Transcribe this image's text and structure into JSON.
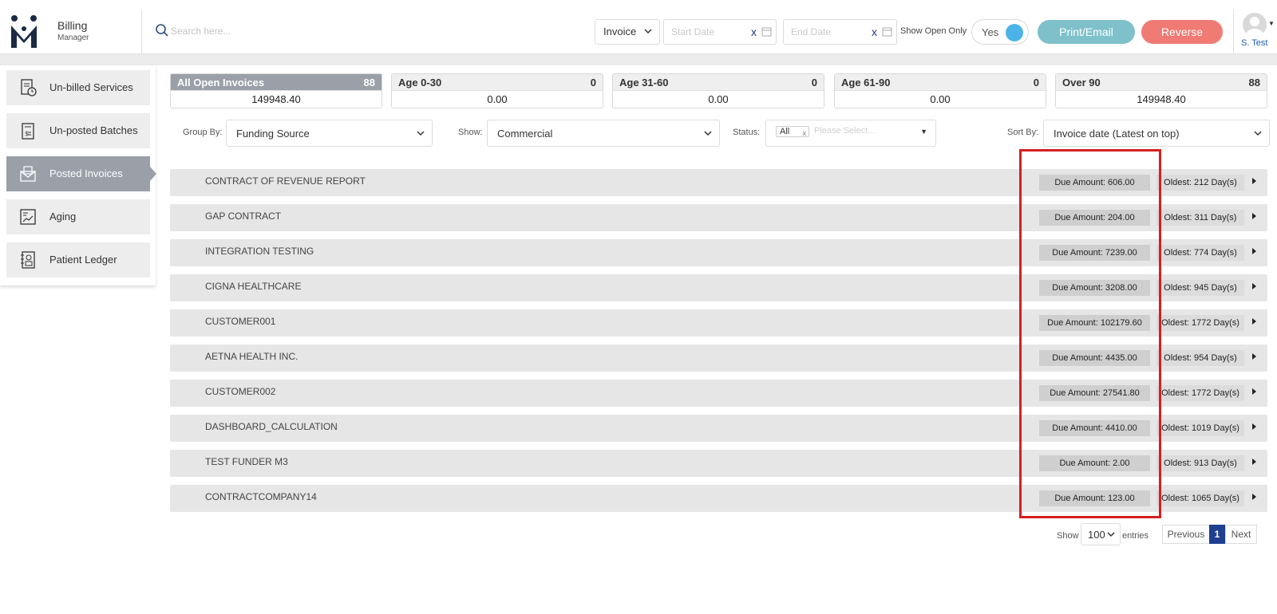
{
  "app": {
    "brand_title": "Billing",
    "brand_subtitle": "Manager"
  },
  "header": {
    "search_placeholder": "Search here...",
    "type_select": "Invoice",
    "start_date_placeholder": "Start Date",
    "end_date_placeholder": "End Date",
    "clear_label": "x",
    "show_open_only_label": "Show Open Only",
    "toggle_value": "Yes",
    "print_email_label": "Print/Email",
    "reverse_label": "Reverse",
    "user_name": "S. Test",
    "colors": {
      "print": "#7ec1cb",
      "reverse": "#ef7b74",
      "toggle": "#4cb3e8"
    }
  },
  "sidebar": {
    "items": [
      {
        "label": "Un-billed Services",
        "icon": "document-clock-icon"
      },
      {
        "label": "Un-posted Batches",
        "icon": "document-dollar-icon"
      },
      {
        "label": "Posted Invoices",
        "icon": "envelope-icon",
        "active": true
      },
      {
        "label": "Aging",
        "icon": "chart-report-icon"
      },
      {
        "label": "Patient Ledger",
        "icon": "ledger-book-icon"
      }
    ]
  },
  "summary": [
    {
      "name": "All Open Invoices",
      "count": "88",
      "amount": "149948.40",
      "active": true
    },
    {
      "name": "Age 0-30",
      "count": "0",
      "amount": "0.00"
    },
    {
      "name": "Age 31-60",
      "count": "0",
      "amount": "0.00"
    },
    {
      "name": "Age 61-90",
      "count": "0",
      "amount": "0.00"
    },
    {
      "name": "Over 90",
      "count": "88",
      "amount": "149948.40"
    }
  ],
  "filters": {
    "group_by_label": "Group By:",
    "group_by_value": "Funding Source",
    "show_label": "Show:",
    "show_value": "Commercial",
    "status_label": "Status:",
    "status_tag": "All",
    "status_tag_remove": "x",
    "status_placeholder": "Please Select...",
    "sort_by_label": "Sort By:",
    "sort_by_value": "Invoice date (Latest on top)"
  },
  "rows": [
    {
      "name": "CONTRACT OF REVENUE REPORT",
      "due": "Due Amount: 606.00",
      "oldest": "Oldest: 212 Day(s)"
    },
    {
      "name": "GAP CONTRACT",
      "due": "Due Amount: 204.00",
      "oldest": "Oldest: 311 Day(s)"
    },
    {
      "name": "INTEGRATION TESTING",
      "due": "Due Amount: 7239.00",
      "oldest": "Oldest: 774 Day(s)"
    },
    {
      "name": "CIGNA HEALTHCARE",
      "due": "Due Amount: 3208.00",
      "oldest": "Oldest: 945 Day(s)"
    },
    {
      "name": "CUSTOMER001",
      "due": "Due Amount: 102179.60",
      "oldest": "Oldest: 1772 Day(s)"
    },
    {
      "name": "AETNA HEALTH INC.",
      "due": "Due Amount: 4435.00",
      "oldest": "Oldest: 954 Day(s)"
    },
    {
      "name": "CUSTOMER002",
      "due": "Due Amount: 27541.80",
      "oldest": "Oldest: 1772 Day(s)"
    },
    {
      "name": "DASHBOARD_CALCULATION",
      "due": "Due Amount: 4410.00",
      "oldest": "Oldest: 1019 Day(s)"
    },
    {
      "name": "TEST FUNDER M3",
      "due": "Due Amount: 2.00",
      "oldest": "Oldest: 913 Day(s)"
    },
    {
      "name": "CONTRACTCOMPANY14",
      "due": "Due Amount: 123.00",
      "oldest": "Oldest: 1065 Day(s)"
    }
  ],
  "pagination": {
    "show_label": "Show",
    "page_size": "100",
    "entries_label": "entries",
    "previous_label": "Previous",
    "current_page": "1",
    "next_label": "Next"
  }
}
